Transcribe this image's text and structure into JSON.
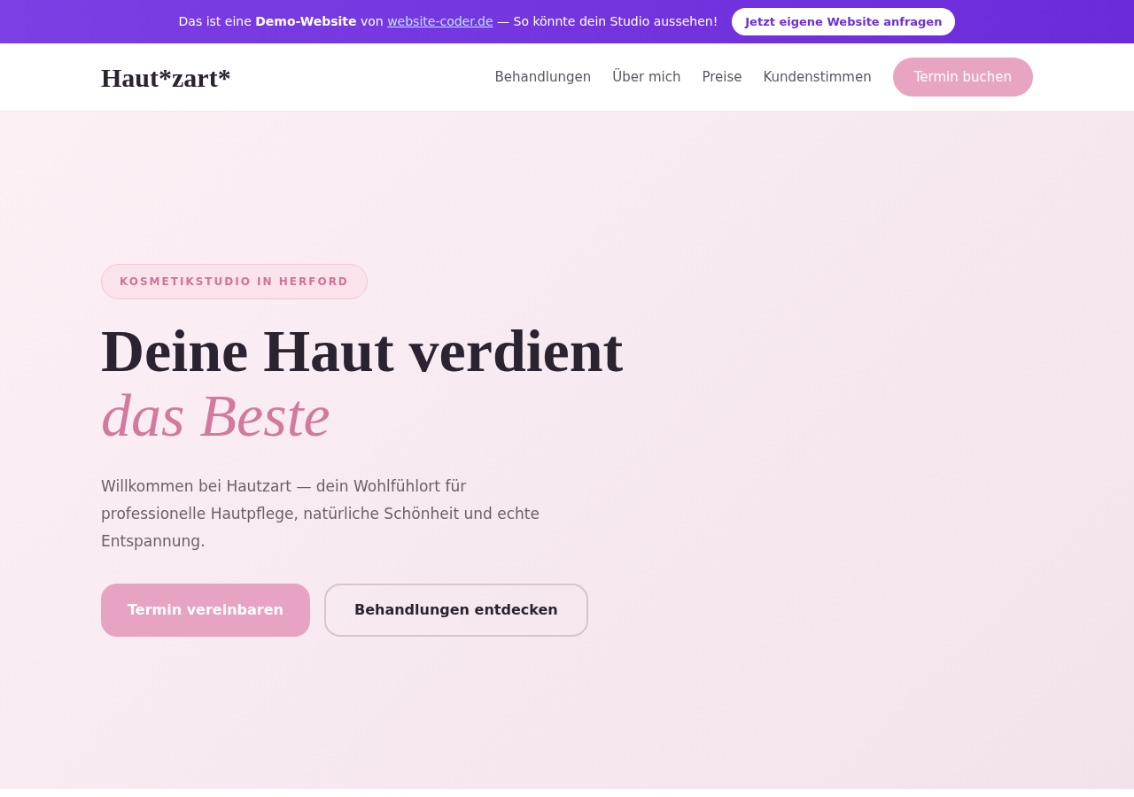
{
  "banner": {
    "text_before": "Das ist eine **Demo-Website** von",
    "link": "website-coder.de",
    "text_after": "— So könnte dein Studio aussehen!",
    "button": "Jetzt eigene Website anfragen"
  },
  "navbar": {
    "logo": "Haut*zart*",
    "links": [
      "Behandlungen",
      "Über mich",
      "Preise",
      "Kundenstimmen"
    ],
    "cta": "Termin buchen"
  },
  "hero": {
    "eyebrow": "KOSMETIKSTUDIO IN HERFORD",
    "headline": "Deine Haut verdient",
    "headline_accent": "das Beste",
    "intro": "Willkommen bei Hautzart — dein Wohlfühlort für professionelle Hautpflege, natürliche Schönheit und echte Entspannung.",
    "buttons": [
      {
        "label": "Termin vereinbaren",
        "kind": "primary"
      },
      {
        "label": "Behandlungen entdecken",
        "kind": "outline"
      }
    ]
  }
}
